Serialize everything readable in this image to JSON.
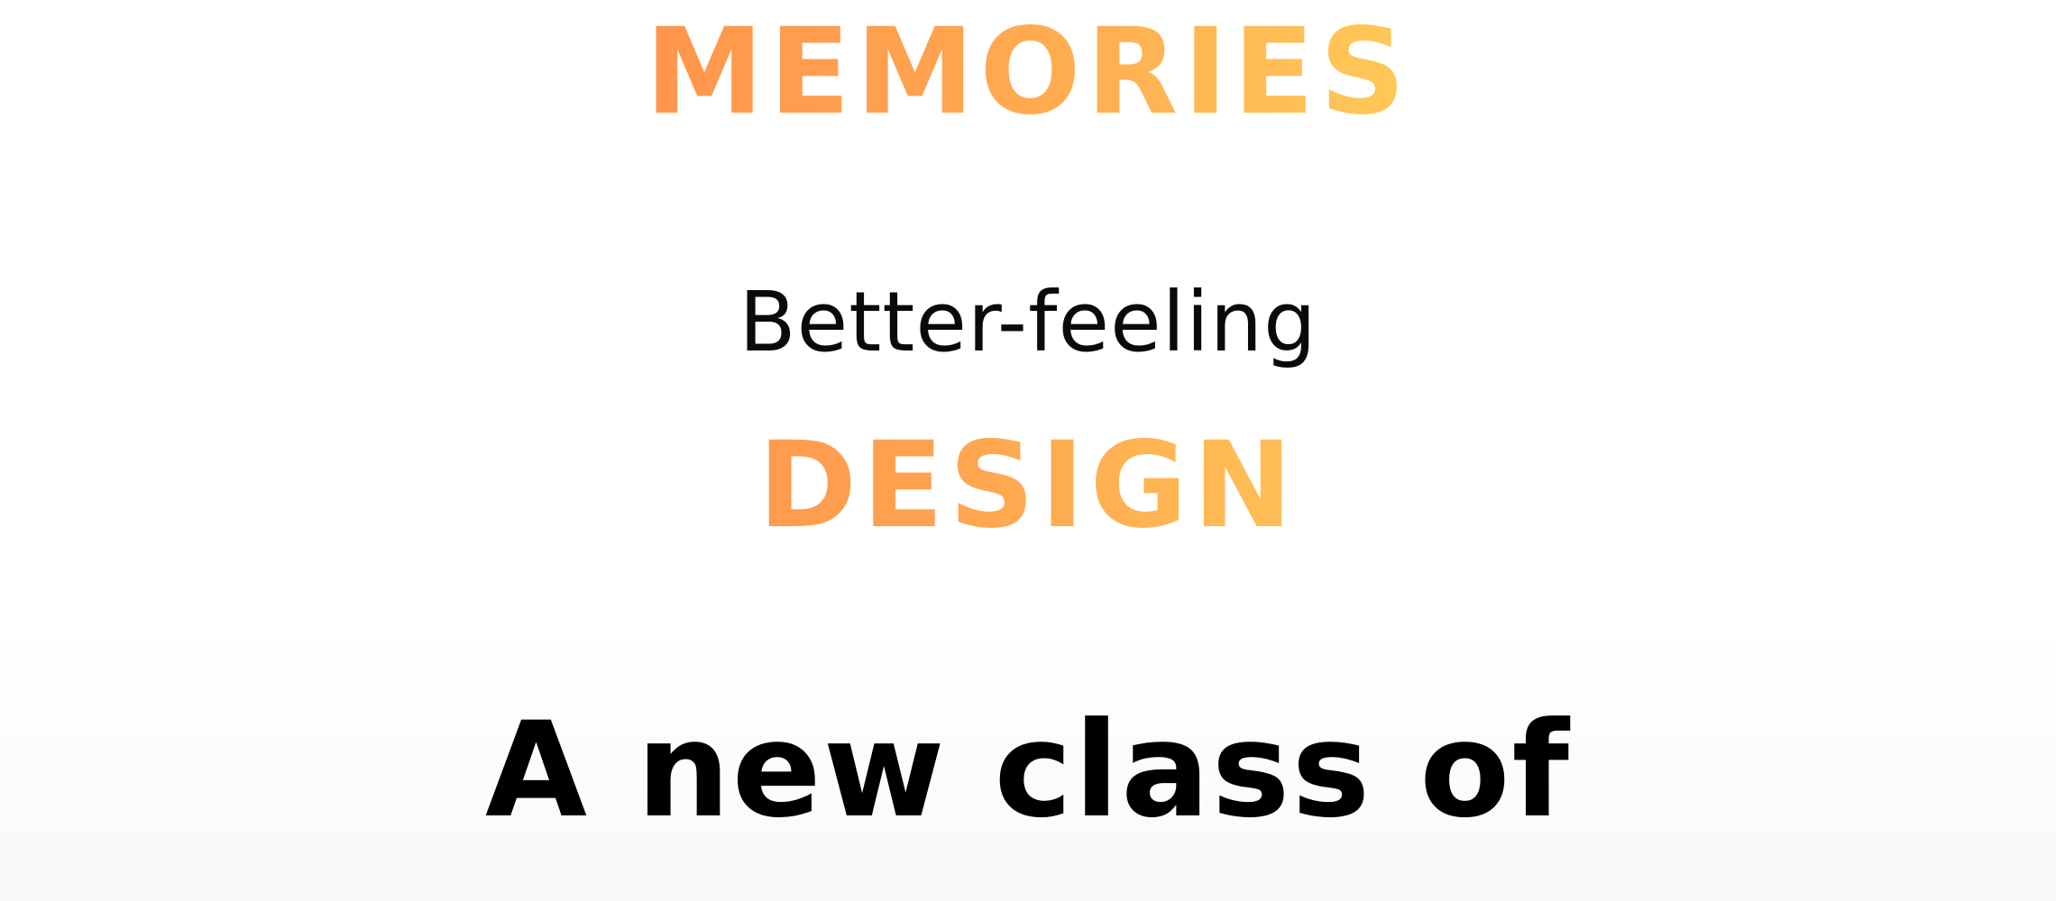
{
  "hero": {
    "word_top": "MEMORIES",
    "subtitle": "Better-feeling",
    "word_middle": "DESIGN",
    "headline": "A new class of"
  },
  "colors": {
    "gradient_start": "#ff7a45",
    "gradient_end": "#ffe865",
    "text": "#000000",
    "background": "#ffffff"
  }
}
